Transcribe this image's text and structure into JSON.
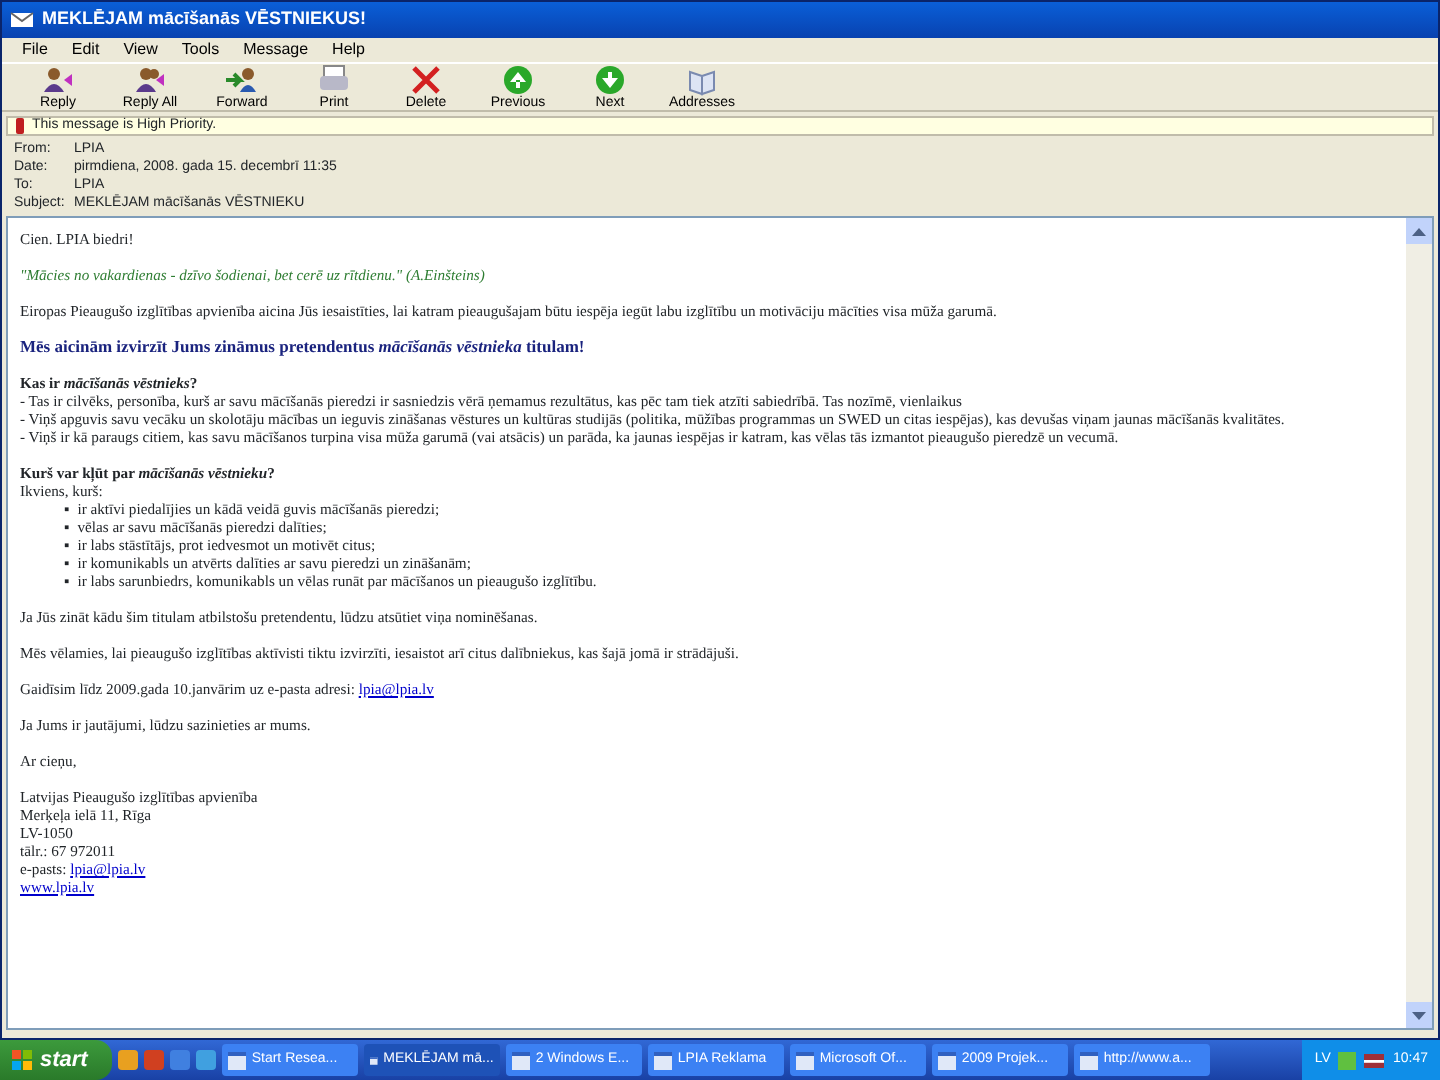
{
  "window": {
    "title": "MEKLĒJAM mācīšanās VĒSTNIEKUS!"
  },
  "menu": [
    "File",
    "Edit",
    "View",
    "Tools",
    "Message",
    "Help"
  ],
  "toolbar": [
    {
      "label": "Reply",
      "kind": "reply"
    },
    {
      "label": "Reply All",
      "kind": "replyall"
    },
    {
      "label": "Forward",
      "kind": "forward"
    },
    {
      "label": "Print",
      "kind": "print"
    },
    {
      "label": "Delete",
      "kind": "delete"
    },
    {
      "label": "Previous",
      "kind": "previous"
    },
    {
      "label": "Next",
      "kind": "next"
    },
    {
      "label": "Addresses",
      "kind": "addresses"
    }
  ],
  "priority_banner": "This message is High Priority.",
  "headers": [
    {
      "label": "From:",
      "value": "LPIA"
    },
    {
      "label": "Date:",
      "value": "pirmdiena, 2008. gada 15. decembrī 11:35"
    },
    {
      "label": "To:",
      "value": "LPIA"
    },
    {
      "label": "Subject:",
      "value": "MEKLĒJAM mācīšanās VĒSTNIEKU"
    }
  ],
  "body": [
    {
      "kind": "p",
      "text": "Cien. LPIA biedri!"
    },
    {
      "kind": "quote",
      "text": "\"Mācies no vakardienas - dzīvo šodienai, bet cerē uz rītdienu.\" (A.Einšteins)"
    },
    {
      "kind": "p",
      "text": "Eiropas Pieaugušo izglītības apvienība aicina Jūs iesaistīties, lai katram pieaugušajam būtu iespēja iegūt labu izglītību un motivāciju mācīties visa mūža garumā."
    },
    {
      "kind": "heading",
      "text": "Mēs aicinām izvirzīt Jums zināmus pretendentus *mācīšanās vēstnieka* titulam!"
    },
    {
      "kind": "lines",
      "title": "Kas ir *mācīšanās vēstnieks*?",
      "lines": [
        "- Tas ir cilvēks, personība, kurš ar savu mācīšanās pieredzi ir sasniedzis vērā ņemamus rezultātus, kas pēc tam tiek atzīti sabiedrībā. Tas nozīmē, vienlaikus",
        "- Viņš apguvis savu vecāku un skolotāju mācības un ieguvis zināšanas vēstures un kultūras studijās (politika, mūžības programmas un SWED un citas iespējas), kas devušas viņam jaunas mācīšanās kvalitātes.",
        "- Viņš ir kā paraugs citiem, kas savu mācīšanos turpina visa mūža garumā (vai atsācis) un parāda, ka jaunas iespējas ir katram, kas vēlas tās izmantot pieaugušo pieredzē un vecumā."
      ]
    },
    {
      "kind": "bullets",
      "title": "Kurš var kļūt par *mācīšanās vēstnieku*?",
      "intro": "Ikviens, kurš:",
      "marker": "▪",
      "items": [
        "ir aktīvi piedalījies un kādā veidā guvis mācīšanās pieredzi;",
        "vēlas ar savu mācīšanās pieredzi dalīties;",
        "ir labs stāstītājs, prot iedvesmot un motivēt citus;",
        "ir komunikabls un atvērts dalīties ar savu pieredzi un zināšanām;",
        "ir labs sarunbiedrs, komunikabls un vēlas runāt par mācīšanos un pieaugušo izglītību."
      ]
    },
    {
      "kind": "p",
      "text": "Ja Jūs zināt kādu šim titulam atbilstošu pretendentu, lūdzu atsūtiet viņa nominēšanas."
    },
    {
      "kind": "p",
      "text": "Mēs vēlamies, lai pieaugušo izglītības aktīvisti tiktu izvirzīti, iesaistot arī citus dalībniekus, kas šajā jomā ir strādājuši."
    },
    {
      "kind": "p",
      "text": "Gaidīsim līdz 2009.gada 10.janvārim uz e-pasta adresi: ",
      "link": "lpia@lpia.lv"
    },
    {
      "kind": "p",
      "text": "Ja Jums ir jautājumi, lūdzu sazinieties ar mums."
    },
    {
      "kind": "p",
      "text": "Ar cieņu,"
    },
    {
      "kind": "signature",
      "lines": [
        {
          "kind": "text",
          "text": "Latvijas Pieaugušo izglītības apvienība"
        },
        {
          "kind": "text",
          "text": "Merķeļa ielā 11, Rīga"
        },
        {
          "kind": "text",
          "text": "LV-1050"
        },
        {
          "kind": "text",
          "text": "tālr.: 67 972011"
        },
        {
          "kind": "mail",
          "label": "e-pasts: ",
          "text": "lpia@lpia.lv"
        },
        {
          "kind": "link",
          "text": "www.lpia.lv"
        }
      ]
    }
  ],
  "taskbar": {
    "start": "start",
    "buttons": [
      {
        "label": "Start Resea...",
        "selected": false
      },
      {
        "label": "MEKLĒJAM mā...",
        "selected": true
      },
      {
        "label": "2 Windows E...",
        "selected": false
      },
      {
        "label": "LPIA Reklama",
        "selected": false
      },
      {
        "label": "Microsoft Of...",
        "selected": false
      },
      {
        "label": "2009 Projek...",
        "selected": false
      },
      {
        "label": "http://www.a...",
        "selected": false
      }
    ],
    "language": "LV",
    "clock": "10:47"
  }
}
